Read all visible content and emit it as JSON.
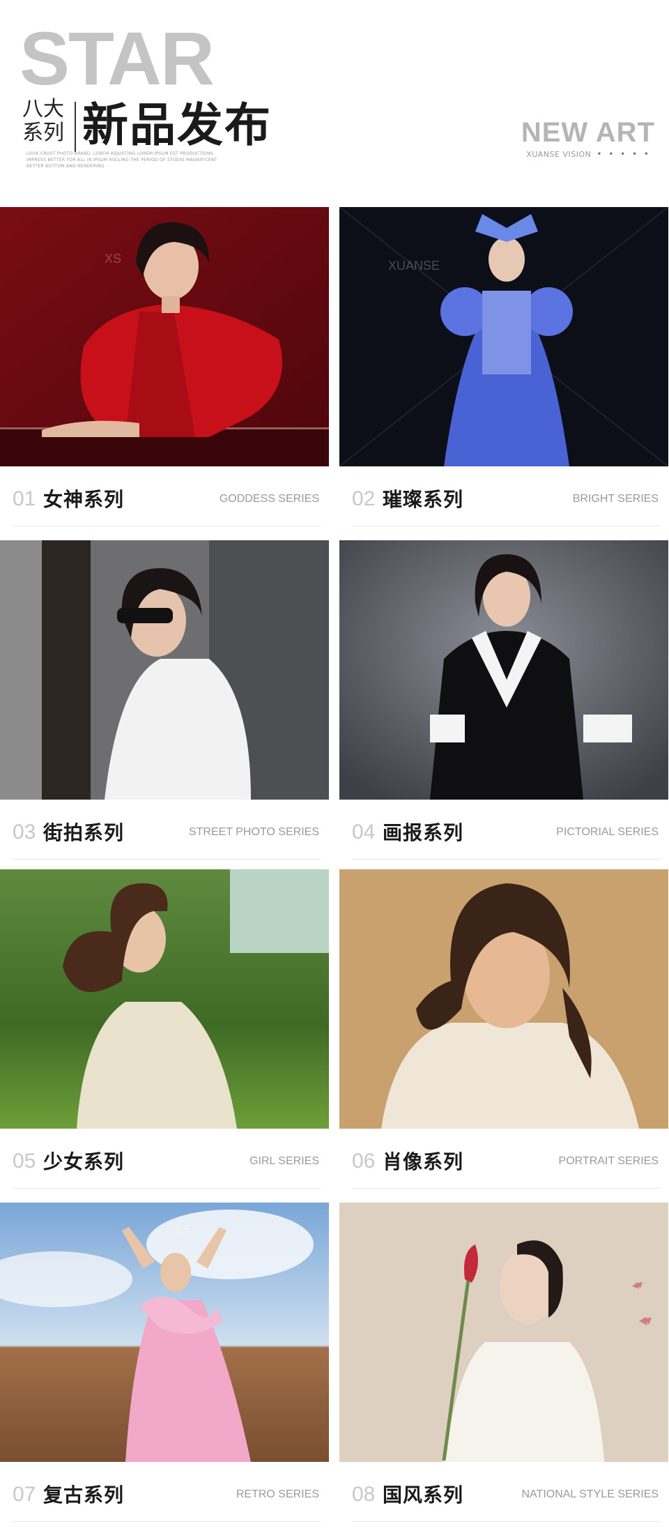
{
  "header": {
    "star": "STAR",
    "ba_da": "八大",
    "xi_lie": "系列",
    "title": "新品发布",
    "fineprint": "LOOK CRUST PHOTO BRAND, LOREM ADJUSTING LOREM IPSUM EST PRODUCTIONS IMPRESS BETTER FOR ALL IN IPSUM ROLLING THE PERIOD OF STUDIO MAGNIFICENT BETTER BOTTOM AND RENDERING",
    "new_art": "NEW ART",
    "vision": "XUANSE VISION",
    "dots": "• • • • •"
  },
  "watermarks": {
    "xs": "XS",
    "xuanse": "XUANSE"
  },
  "series": [
    {
      "num": "01",
      "name": "女神系列",
      "en": "GODDESS SERIES"
    },
    {
      "num": "02",
      "name": "璀璨系列",
      "en": "BRIGHT SERIES"
    },
    {
      "num": "03",
      "name": "街拍系列",
      "en": "STREET PHOTO SERIES"
    },
    {
      "num": "04",
      "name": "画报系列",
      "en": "PICTORIAL SERIES"
    },
    {
      "num": "05",
      "name": "少女系列",
      "en": "GIRL SERIES"
    },
    {
      "num": "06",
      "name": "肖像系列",
      "en": "PORTRAIT SERIES"
    },
    {
      "num": "07",
      "name": "复古系列",
      "en": "RETRO SERIES"
    },
    {
      "num": "08",
      "name": "国风系列",
      "en": "NATIONAL STYLE SERIES"
    }
  ]
}
